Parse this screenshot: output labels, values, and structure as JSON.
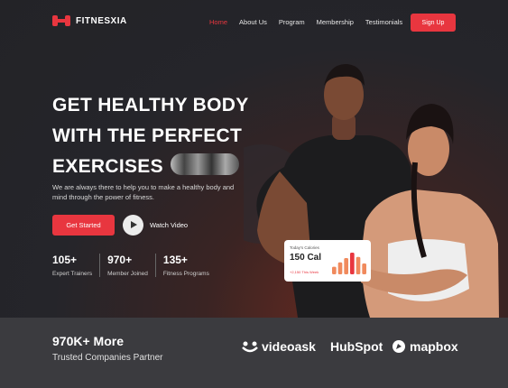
{
  "nav": {
    "logo_text": "FITNESXIA",
    "items": [
      "Home",
      "About Us",
      "Program",
      "Membership",
      "Testimonials"
    ],
    "signup_label": "Sign Up"
  },
  "hero": {
    "headline_line1": "GET HEALTHY BODY",
    "headline_line2": "WITH THE PERFECT",
    "headline_line3": "EXERCISES",
    "subtext": "We are always there to help you to make a healthy body and mind through the power of fitness.",
    "cta_label": "Get Started",
    "watch_label": "Watch Video",
    "stats": [
      {
        "num": "105+",
        "label": "Expert Trainers"
      },
      {
        "num": "970+",
        "label": "Member Joined"
      },
      {
        "num": "135+",
        "label": "Fitness Programs"
      }
    ]
  },
  "calorie_card": {
    "title": "Today's Calories",
    "value": "150 Cal",
    "subtitle": "+2,150 This Week",
    "bar_levels": [
      0.35,
      0.55,
      0.75,
      1.0,
      0.8,
      0.5
    ]
  },
  "partners": {
    "title": "970K+ More",
    "subtitle": "Trusted Companies Partner",
    "brands": [
      "videoask",
      "HubSpot",
      "mapbox"
    ]
  },
  "colors": {
    "accent": "#e8363f",
    "bg_dark": "#232327",
    "band": "#3b3b3f"
  }
}
